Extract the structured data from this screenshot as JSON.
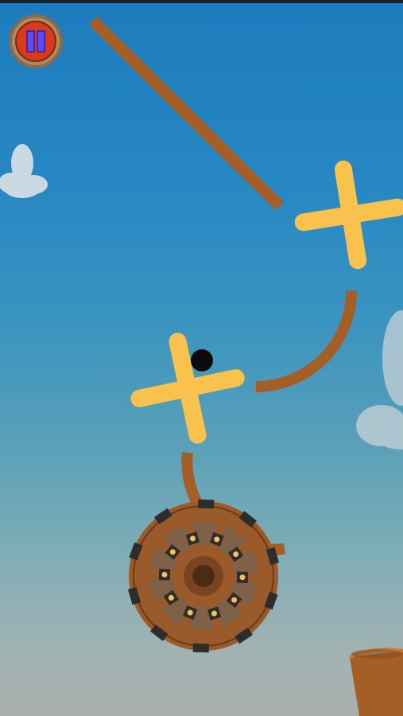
{
  "game": {
    "name": "ball-physics-puzzle"
  },
  "controls": {
    "pause_button": {
      "icon": "pause-icon",
      "state": "unpaused"
    }
  },
  "colors": {
    "sky_top": "#1c7cbd",
    "sky_bottom": "#aab0ad",
    "plank": "#a55e25",
    "spinner": "#f8c24d",
    "ball": "#0b0b0b",
    "wheel_wood": "#9b5a28",
    "wheel_dark": "#4a2b14",
    "wheel_metal": "#2d2d2d",
    "rivet": "#f4c15a",
    "cup": "#a55e25",
    "cloud": "#dde3e6",
    "pause_frame": "#8a6a4a",
    "pause_red": "#d83a1c",
    "pause_bar": "#5b4dff"
  },
  "level_objects": {
    "ball": "ball",
    "spinners": [
      "spinner-cross-upper",
      "spinner-cross-lower"
    ],
    "planks": [
      "diagonal-plank",
      "curved-ramp-upper",
      "curved-ramp-lower"
    ],
    "wheel": "wooden-wheel",
    "goal": "goal-cup"
  }
}
